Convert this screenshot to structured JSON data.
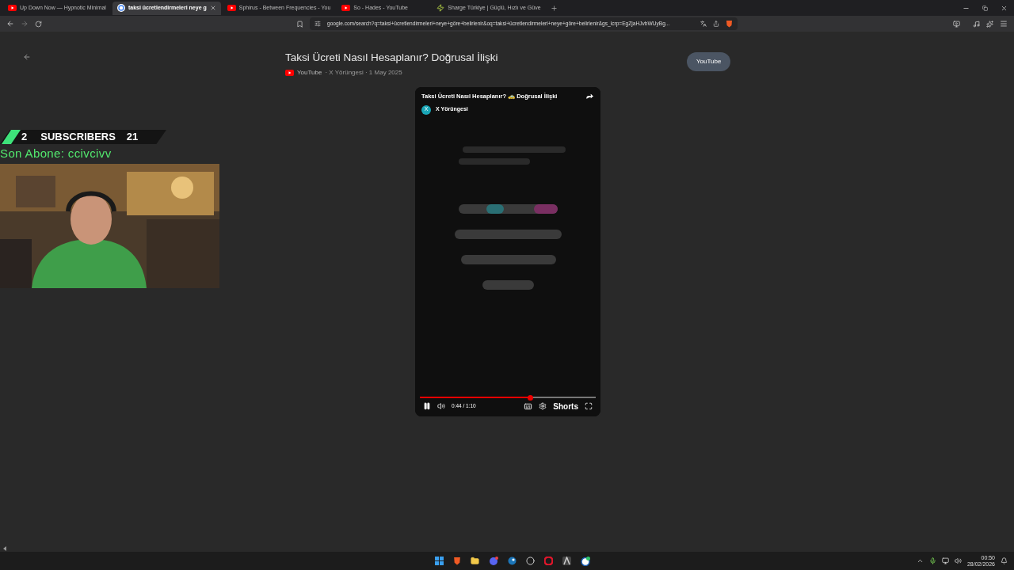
{
  "tabs": [
    {
      "title": "Up Down Now — Hypnotic Minimal",
      "kind": "youtube",
      "selected": false
    },
    {
      "title": "taksi ücretlendirmeleri neye g",
      "kind": "google",
      "selected": true
    },
    {
      "title": "Sphirus - Between Frequencies - You",
      "kind": "youtube",
      "selected": false
    },
    {
      "title": "So - Hades - YouTube",
      "kind": "youtube",
      "selected": false
    },
    {
      "title": "Sharge Türkiye | Güçlü, Hızlı ve Güve",
      "kind": "bolt",
      "selected": false
    }
  ],
  "address_bar": {
    "url": "google.com/search?q=taksi+ücretlendirmeleri+neye+göre+belirlenir&oq=taksi+ücretlendirmeleri+neye+göre+belirlenir&gs_lcrp=EgZjaHJvbWUyBg..."
  },
  "result": {
    "title": "Taksi Ücreti Nasıl Hesaplanır? Doğrusal İlişki",
    "source": "YouTube",
    "meta": "· X Yörüngesi · 1 May 2025",
    "chip": "YouTube"
  },
  "player": {
    "title": "Taksi Ücreti Nasıl Hesaplanır? 🚕 Doğrusal İlişki",
    "channel_initial": "X",
    "channel": "X Yörüngesi",
    "time": "0:44 / 1:10",
    "shorts": "Shorts",
    "level": 0.63,
    "playing": true
  },
  "stream_overlay": {
    "left_count": "2",
    "label": "SUBSCRIBERS",
    "right_count": "21",
    "last_subscriber": "Son Abone: ccivcivv"
  },
  "taskbar": {
    "time": "00:50",
    "date": "28/02/2026"
  }
}
